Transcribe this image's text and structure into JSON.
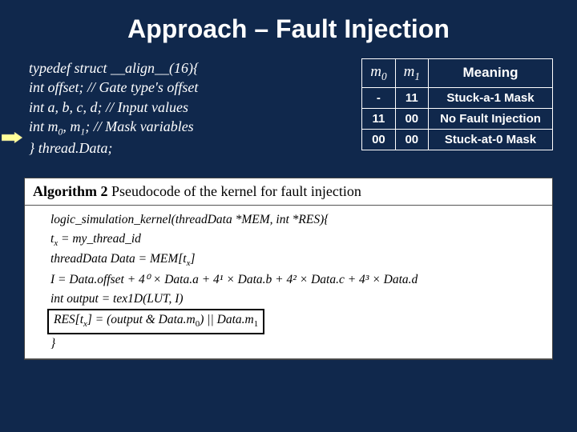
{
  "title": "Approach – Fault Injection",
  "struct": {
    "l1": "typedef struct __align__(16){",
    "l2_a": "int offset; ",
    "l2_b": "// Gate type's offset",
    "l3_a": "int a, b, c, d; ",
    "l3_b": "// Input values",
    "l4_a": "int m",
    "l4_b": ", m",
    "l4_c": "; ",
    "l4_d": "// Mask variables",
    "l5": "} thread.Data;"
  },
  "table": {
    "h_m0": "m",
    "h_m1": "m",
    "h_meaning": "Meaning",
    "rows": [
      {
        "m0": "-",
        "m1": "11",
        "meaning": "Stuck-a-1 Mask"
      },
      {
        "m0": "11",
        "m1": "00",
        "meaning": "No Fault Injection"
      },
      {
        "m0": "00",
        "m1": "00",
        "meaning": "Stuck-at-0 Mask"
      }
    ]
  },
  "algo": {
    "title_b": "Algorithm 2",
    "title_rest": " Pseudocode of the kernel for fault injection",
    "l1": "logic_simulation_kernel(threadData *MEM, int *RES){",
    "l2_a": "t",
    "l2_b": " = my_thread_id",
    "l3_a": "threadData Data = MEM[t",
    "l3_b": "]",
    "l4": "I = Data.offset + 4⁰ × Data.a + 4¹ × Data.b + 4² × Data.c + 4³ × Data.d",
    "l5": "int output = tex1D(LUT, I)",
    "l6_a": "RES[t",
    "l6_b": "] = (output & Data.m",
    "l6_c": ") || Data.m",
    "l7": "}"
  }
}
